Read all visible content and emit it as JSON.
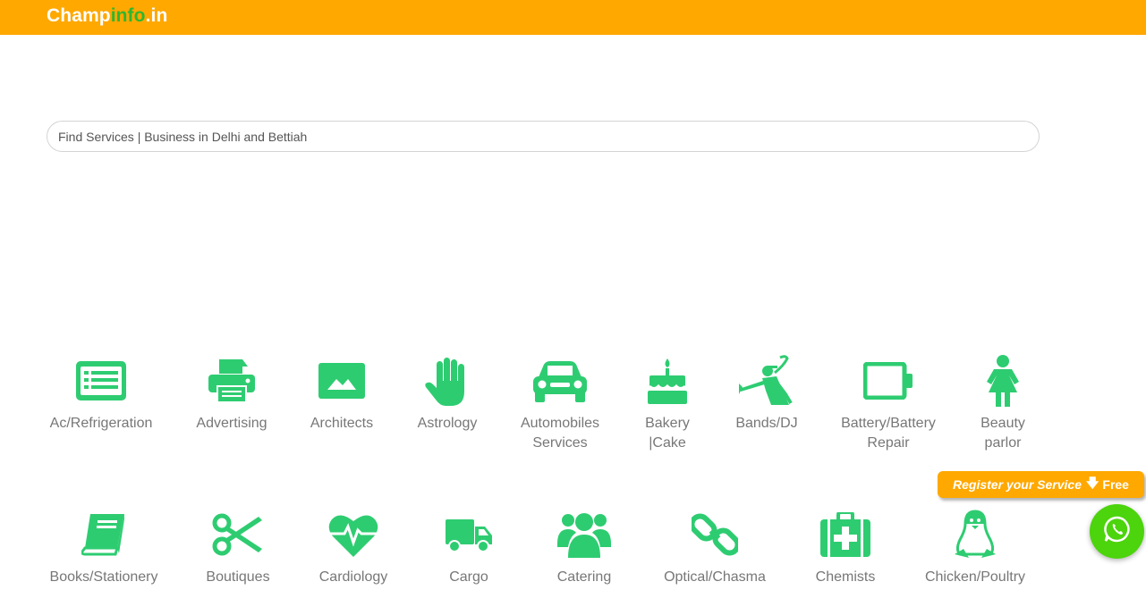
{
  "header": {
    "logo_part1": "Champ",
    "logo_part2": "info",
    "logo_part3": ".in",
    "bg_color": "#FFA800",
    "logo_accent": "#2FB62F"
  },
  "search": {
    "placeholder": "Find Services | Business in Delhi and Bettiah",
    "value": ""
  },
  "categories": {
    "row1": [
      {
        "label": "Ac/Refrigeration",
        "icon": "list-alt-icon"
      },
      {
        "label": "Advertising",
        "icon": "printer-icon"
      },
      {
        "label": "Architects",
        "icon": "image-icon"
      },
      {
        "label": "Astrology",
        "icon": "hand-icon"
      },
      {
        "label": "Automobiles Services",
        "icon": "car-icon"
      },
      {
        "label": "Bakery |Cake",
        "icon": "birthday-cake-icon"
      },
      {
        "label": "Bands/DJ",
        "icon": "trumpet-player-icon"
      },
      {
        "label": "Battery/Battery Repair",
        "icon": "battery-icon"
      },
      {
        "label": "Beauty parlor",
        "icon": "female-icon"
      }
    ],
    "row2": [
      {
        "label": "Books/Stationery",
        "icon": "book-icon"
      },
      {
        "label": "Boutiques",
        "icon": "scissors-icon"
      },
      {
        "label": "Cardiology",
        "icon": "heartbeat-icon"
      },
      {
        "label": "Cargo",
        "icon": "truck-icon"
      },
      {
        "label": "Catering",
        "icon": "group-icon"
      },
      {
        "label": "Optical/Chasma",
        "icon": "chain-link-icon"
      },
      {
        "label": "Chemists",
        "icon": "medkit-icon"
      },
      {
        "label": "Chicken/Poultry",
        "icon": "penguin-icon"
      }
    ],
    "icon_color": "#2ECC71"
  },
  "register_button": {
    "label": "Register your Service",
    "arrow": "🡇",
    "free_label": "Free"
  },
  "whatsapp": {
    "icon": "whatsapp-icon",
    "color": "#4CD40C"
  }
}
